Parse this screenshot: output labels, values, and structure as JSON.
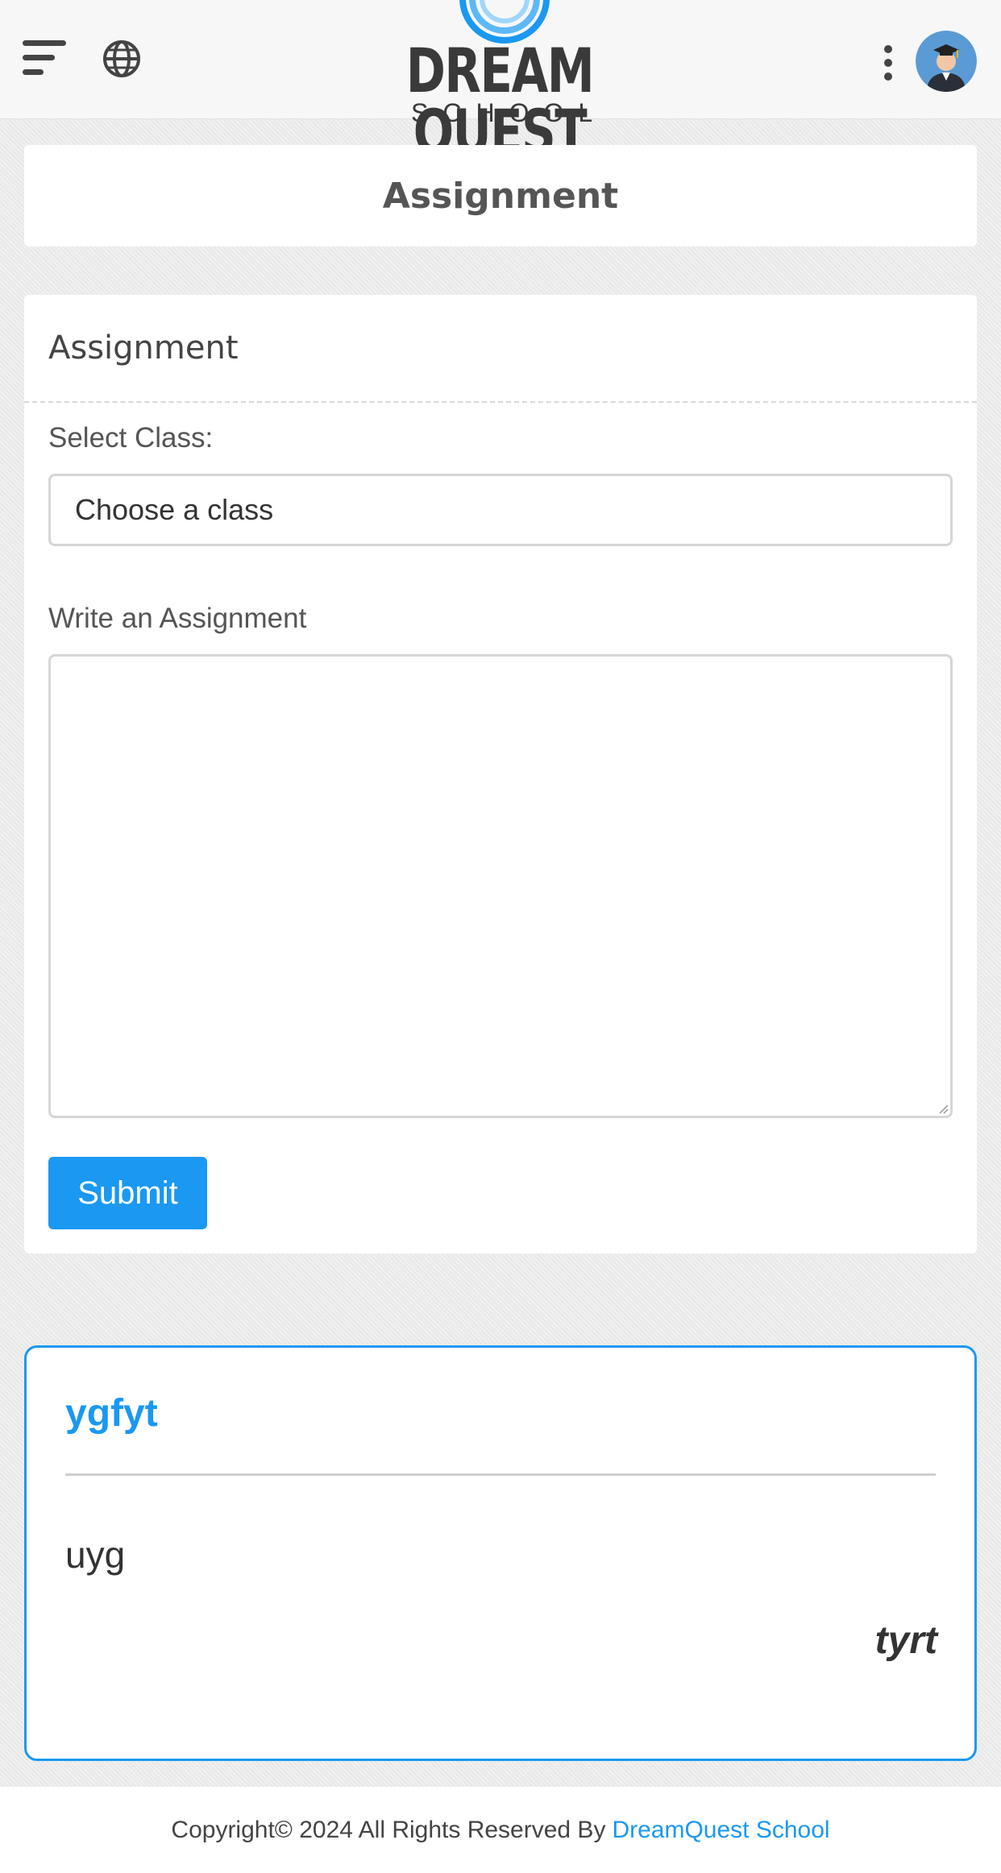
{
  "header": {
    "logo_title": "DREAM QUEST",
    "logo_sub": "SCHOOL",
    "menu_icon": "hamburger-menu-icon",
    "language_icon": "globe-icon",
    "more_icon": "vertical-dots-icon",
    "avatar_icon": "graduate-avatar"
  },
  "page": {
    "title": "Assignment"
  },
  "form": {
    "header": "Assignment",
    "class_label": "Select Class:",
    "class_select_value": "Choose a class",
    "assignment_label": "Write an Assignment",
    "assignment_value": "",
    "submit_label": "Submit"
  },
  "posts": [
    {
      "title": "ygfyt",
      "body": "uyg",
      "author": "tyrt"
    }
  ],
  "footer": {
    "copyright": "Copyright© 2024 All Rights Reserved By",
    "link_text": "DreamQuest School"
  },
  "colors": {
    "accent": "#1a98f2",
    "background": "#ececec",
    "text": "#444444"
  }
}
